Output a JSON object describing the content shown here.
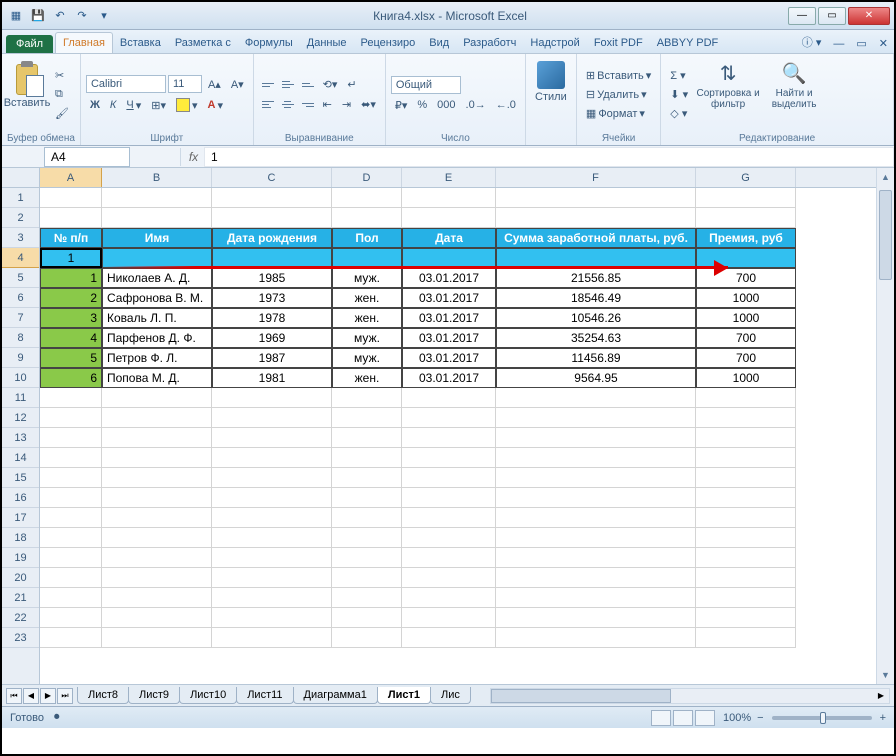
{
  "titlebar": {
    "title": "Книга4.xlsx - Microsoft Excel"
  },
  "tabs": {
    "file": "Файл",
    "items": [
      "Главная",
      "Вставка",
      "Разметка с",
      "Формулы",
      "Данные",
      "Рецензиро",
      "Вид",
      "Разработч",
      "Надстрой",
      "Foxit PDF",
      "ABBYY PDF"
    ],
    "active_index": 0
  },
  "ribbon": {
    "paste": "Вставить",
    "clipboard_label": "Буфер обмена",
    "font_name": "Calibri",
    "font_size": "11",
    "font_label": "Шрифт",
    "align_label": "Выравнивание",
    "number_format": "Общий",
    "number_label": "Число",
    "styles_btn": "Стили",
    "insert": "Вставить",
    "delete": "Удалить",
    "format": "Формат",
    "cells_label": "Ячейки",
    "sort": "Сортировка и фильтр",
    "find": "Найти и выделить",
    "editing_label": "Редактирование"
  },
  "formula_bar": {
    "name_box": "A4",
    "formula": "1"
  },
  "columns": [
    "A",
    "B",
    "C",
    "D",
    "E",
    "F",
    "G"
  ],
  "row_count": 23,
  "active_cell_ref": "A4",
  "headers": {
    "num": "№ п/п",
    "name": "Имя",
    "birth": "Дата рождения",
    "sex": "Пол",
    "date": "Дата",
    "salary": "Сумма заработной платы, руб.",
    "bonus": "Премия, руб"
  },
  "selected_row_value": "1",
  "data_rows": [
    {
      "n": "1",
      "name": "Николаев А. Д.",
      "birth": "1985",
      "sex": "муж.",
      "date": "03.01.2017",
      "salary": "21556.85",
      "bonus": "700"
    },
    {
      "n": "2",
      "name": "Сафронова В. М.",
      "birth": "1973",
      "sex": "жен.",
      "date": "03.01.2017",
      "salary": "18546.49",
      "bonus": "1000"
    },
    {
      "n": "3",
      "name": "Коваль Л. П.",
      "birth": "1978",
      "sex": "жен.",
      "date": "03.01.2017",
      "salary": "10546.26",
      "bonus": "1000"
    },
    {
      "n": "4",
      "name": "Парфенов Д. Ф.",
      "birth": "1969",
      "sex": "муж.",
      "date": "03.01.2017",
      "salary": "35254.63",
      "bonus": "700"
    },
    {
      "n": "5",
      "name": "Петров Ф. Л.",
      "birth": "1987",
      "sex": "муж.",
      "date": "03.01.2017",
      "salary": "11456.89",
      "bonus": "700"
    },
    {
      "n": "6",
      "name": "Попова М. Д.",
      "birth": "1981",
      "sex": "жен.",
      "date": "03.01.2017",
      "salary": "9564.95",
      "bonus": "1000"
    }
  ],
  "sheets": {
    "visible": [
      "Лист8",
      "Лист9",
      "Лист10",
      "Лист11",
      "Диаграмма1",
      "Лист1",
      "Лис"
    ],
    "active_index": 5
  },
  "status": {
    "ready": "Готово",
    "zoom": "100%"
  }
}
